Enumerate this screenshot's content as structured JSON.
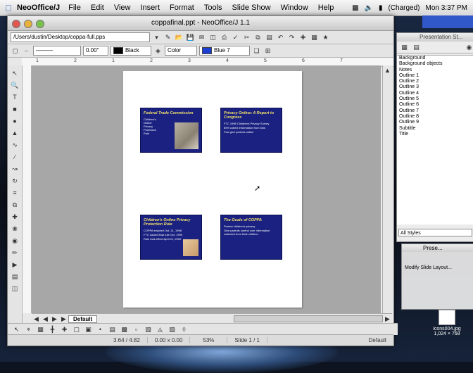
{
  "menubar": {
    "app_name": "NeoOffice/J",
    "items": [
      "File",
      "Edit",
      "View",
      "Insert",
      "Format",
      "Tools",
      "Slide Show",
      "Window",
      "Help"
    ],
    "battery_text": "(Charged)",
    "clock": "Mon 3:37 PM"
  },
  "window": {
    "title": "coppafinal.ppt - NeoOffice/J 1.1",
    "path": "/Users/dustin/Desktop/coppa-full.pps",
    "line_width": "0.00\"",
    "line_color": "Black",
    "area_style": "Color",
    "area_color": "Blue 7"
  },
  "slides": [
    {
      "title": "Federal Trade Commission",
      "lines": [
        "Children's",
        "Online",
        "Privacy",
        "Protection",
        "Rule"
      ]
    },
    {
      "title": "Privacy Online: A Report to Congress",
      "lines": [
        "FTC 1998 Children's Privacy Survey",
        "89% collect information from kids",
        "Few give parents notice"
      ]
    },
    {
      "title": "Children's Online Privacy Protection Rule",
      "lines": [
        "COPPA enacted Oct. 21, 1998",
        "FTC issued final rule Oct. 1999",
        "Rule took effect April 21, 2000"
      ]
    },
    {
      "title": "The Goals of COPPA",
      "lines": [
        "Protect children's privacy",
        "Give parents control over information collected from their children"
      ]
    }
  ],
  "tabs": {
    "default_tab": "Default"
  },
  "status": {
    "position": "3.64 / 4.82",
    "size": "0.00 x 0.00",
    "zoom": "53%",
    "slide": "Slide 1 / 1",
    "layout": "Default"
  },
  "stylist": {
    "title": "Presentation St...",
    "styles": [
      "Background",
      "Background objects",
      "Notes",
      "Outline 1",
      "Outline 2",
      "Outline 3",
      "Outline 4",
      "Outline 5",
      "Outline 6",
      "Outline 7",
      "Outline 8",
      "Outline 9",
      "Subtitle",
      "Title"
    ],
    "filter": "All Styles"
  },
  "presentation_panel": {
    "title": "Prese...",
    "items": [
      "",
      "Modify Slide Layout...",
      "",
      "",
      ""
    ]
  },
  "desktop_icon": {
    "name": "icons004.jpg",
    "info": "1,024 × 768"
  }
}
